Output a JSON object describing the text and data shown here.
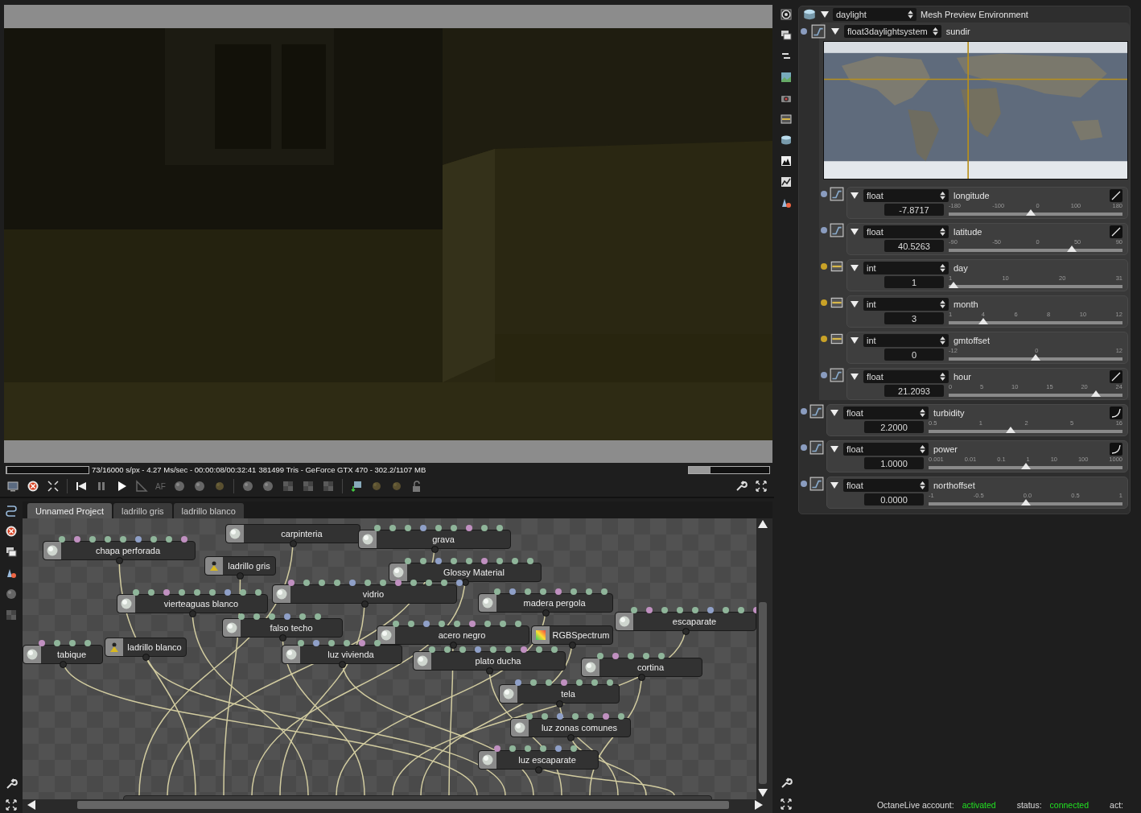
{
  "render_status": {
    "progress": {
      "level": 0.005
    },
    "stats": "73/16000 s/px - 4.27 Ms/sec - 00:00:08/00:32:41",
    "device": "381499 Tris - GeForce GTX 470 - 302.2/1107 MB",
    "memory": {
      "level": 0.27
    }
  },
  "render_toolbar": {
    "focus_label": "AF"
  },
  "node_editor": {
    "tabs": [
      {
        "label": "Unnamed Project",
        "selected": true
      },
      {
        "label": "ladrillo gris",
        "selected": false
      },
      {
        "label": "ladrillo blanco",
        "selected": false
      }
    ],
    "nodes": [
      {
        "label": "carpinteria",
        "kind": "material"
      },
      {
        "label": "grava",
        "kind": "material"
      },
      {
        "label": "chapa perforada",
        "kind": "material"
      },
      {
        "label": "ladrillo gris",
        "kind": "missing"
      },
      {
        "label": "Glossy Material",
        "kind": "material"
      },
      {
        "label": "vidrio",
        "kind": "material"
      },
      {
        "label": "vierteaguas blanco",
        "kind": "material"
      },
      {
        "label": "madera pergola",
        "kind": "material"
      },
      {
        "label": "falso techo",
        "kind": "material"
      },
      {
        "label": "escaparate",
        "kind": "material"
      },
      {
        "label": "RGBSpectrum",
        "kind": "texture"
      },
      {
        "label": "acero negro",
        "kind": "material"
      },
      {
        "label": "tabique",
        "kind": "material"
      },
      {
        "label": "ladrillo blanco",
        "kind": "missing"
      },
      {
        "label": "luz vivienda",
        "kind": "material"
      },
      {
        "label": "plato ducha",
        "kind": "material"
      },
      {
        "label": "cortina",
        "kind": "material"
      },
      {
        "label": "tela",
        "kind": "material"
      },
      {
        "label": "luz zonas comunes",
        "kind": "material"
      },
      {
        "label": "luz escaparate",
        "kind": "material"
      }
    ]
  },
  "environment": {
    "type": "daylight",
    "title": "Mesh Preview Environment",
    "sundir": {
      "type": "float3daylightsystem",
      "name": "sundir",
      "color": "#8a9cbf",
      "params": [
        {
          "kind": "float",
          "type": "float",
          "name": "longitude",
          "value": "-7.8717",
          "ticks": [
            "-180",
            "-100",
            "0",
            "100",
            "180"
          ],
          "level": 0.47,
          "color": "#8a9cbf",
          "scale": {
            "kind": "linear"
          }
        },
        {
          "kind": "float",
          "type": "float",
          "name": "latitude",
          "value": "40.5263",
          "ticks": [
            "-90",
            "-50",
            "0",
            "50",
            "90"
          ],
          "level": 0.72,
          "color": "#8a9cbf",
          "scale": {
            "kind": "linear"
          }
        },
        {
          "kind": "int",
          "type": "int",
          "name": "day",
          "value": "1",
          "ticks": [
            "1",
            "10",
            "20",
            "31"
          ],
          "level": 0.0,
          "color": "#c9a227"
        },
        {
          "kind": "int",
          "type": "int",
          "name": "month",
          "value": "3",
          "ticks": [
            "1",
            "4",
            "6",
            "8",
            "10",
            "12"
          ],
          "level": 0.18,
          "color": "#c9a227"
        },
        {
          "kind": "int",
          "type": "int",
          "name": "gmtoffset",
          "value": "0",
          "ticks": [
            "-12",
            "0",
            "12"
          ],
          "level": 0.5,
          "color": "#c9a227"
        },
        {
          "kind": "float",
          "type": "float",
          "name": "hour",
          "value": "21.2093",
          "ticks": [
            "0",
            "5",
            "10",
            "15",
            "20",
            "24"
          ],
          "level": 0.87,
          "color": "#8a9cbf",
          "scale": {
            "kind": "linear"
          }
        }
      ]
    },
    "params": [
      {
        "kind": "float",
        "type": "float",
        "name": "turbidity",
        "value": "2.2000",
        "ticks": [
          "0.5",
          "1",
          "2",
          "5",
          "16"
        ],
        "level": 0.42,
        "color": "#8a9cbf",
        "scale": {
          "kind": "curve"
        }
      },
      {
        "kind": "float",
        "type": "float",
        "name": "power",
        "value": "1.0000",
        "ticks": [
          "0.001",
          "0.01",
          "0.1",
          "1",
          "10",
          "100",
          "1000"
        ],
        "level": 0.5,
        "color": "#8a9cbf",
        "scale": {
          "kind": "curve"
        }
      },
      {
        "kind": "float",
        "type": "float",
        "name": "northoffset",
        "value": "0.0000",
        "ticks": [
          "-1",
          "-0.5",
          "0.0",
          "0.5",
          "1"
        ],
        "level": 0.5,
        "color": "#8a9cbf"
      }
    ]
  },
  "status_bar": {
    "account_label": "OctaneLive account:",
    "account": "activated",
    "status_label": "status:",
    "status": "connected",
    "act_label": "act:"
  }
}
